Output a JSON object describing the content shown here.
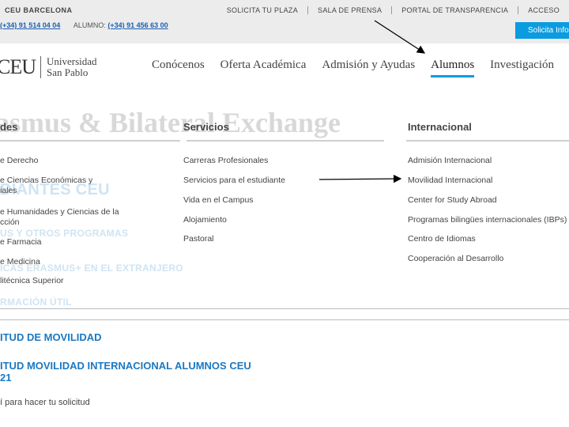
{
  "topbar": {
    "brand": "CEU BARCELONA",
    "phone_general": "(+34) 91 514 04 04",
    "students_label": "ALUMNO:",
    "phone_students": "(+34) 91 456 63 00",
    "links": [
      "SOLICITA TU PLAZA",
      "SALA DE PRENSA",
      "PORTAL DE TRANSPARENCIA",
      "ACCESO"
    ],
    "cta": "Solicita Info"
  },
  "logo": {
    "mark": "CEU",
    "line1": "Universidad",
    "line2": "San Pablo"
  },
  "nav": {
    "items": [
      "Conócenos",
      "Oferta Académica",
      "Admisión y Ayudas",
      "Alumnos",
      "Investigación"
    ],
    "active": "Alumnos"
  },
  "background": {
    "title": "asmus & Bilateral Exchange",
    "line1": "DIANTES CEU",
    "line2": "US Y OTROS PROGRAMAS",
    "line3": "ICAS ERASMUS+ EN EL EXTRANJERO",
    "line4": "RMACIÓN ÚTIL"
  },
  "menu": {
    "col1": {
      "heading": "des",
      "items": [
        "e Derecho",
        "e Ciencias Económicas y",
        "iales",
        "e Humanidades y Ciencias de la",
        "cción",
        "e Farmacia",
        "e Medicina",
        "litécnica Superior"
      ]
    },
    "col2": {
      "heading": "Servicios",
      "items": [
        "Carreras Profesionales",
        "Servicios para el estudiante",
        "Vida en el Campus",
        "Alojamiento",
        "Pastoral"
      ]
    },
    "col3": {
      "heading": "Internacional",
      "items": [
        "Admisión Internacional",
        "Movilidad Internacional",
        "Center for Study Abroad",
        "Programas bilingües internacionales (IBPs)",
        "Centro de Idiomas",
        "Cooperación al Desarrollo"
      ]
    }
  },
  "content": {
    "head1": "ITUD DE MOVILIDAD",
    "head2a": "ITUD MOVILIDAD INTERNACIONAL ALUMNOS CEU",
    "head2b": "21",
    "note": "í para hacer tu solicitud"
  },
  "colors": {
    "accent": "#0a9be0",
    "link_blue": "#1b78c2",
    "topbar_bg": "#ececec"
  }
}
